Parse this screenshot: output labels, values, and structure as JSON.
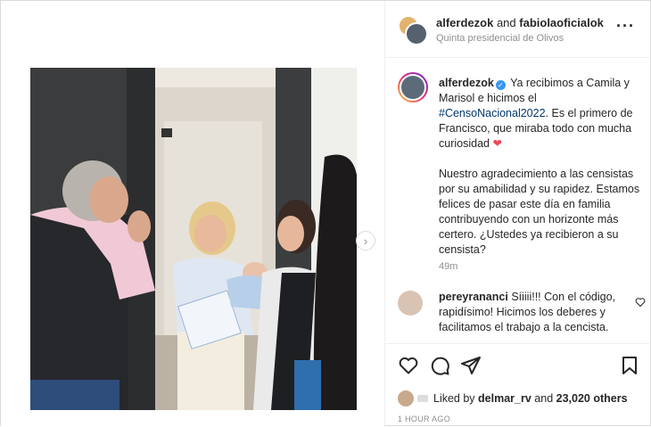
{
  "post": {
    "header": {
      "author": "alferdezok",
      "and": "and",
      "coauthor": "fabiolaoficialok",
      "location": "Quinta presidencial de Olivos",
      "more_icon": "more-horizontal-icon"
    },
    "caption": {
      "username": "alferdezok",
      "text_1": "Ya recibimos a Camila y Marisol e hicimos el",
      "hashtag": "#CensoNacional2022",
      "text_2": ". Es el primero de Francisco, que miraba todo con mucha curiosidad",
      "heart": "❤",
      "text_3": "Nuestro agradecimiento a las censistas por su amabilidad y su rapidez. Estamos felices de pasar este día en familia contribuyendo con un horizonte más certero. ¿Ustedes ya recibieron a su censista?",
      "time": "49m"
    },
    "comments": [
      {
        "username": "pereyrananci",
        "text": "Síiiii!!! Con el código, rapidísimo! Hicimos los deberes y facilitamos el trabajo a la cencista."
      }
    ],
    "likes": {
      "prefix": "Liked by",
      "user": "delmar_rv",
      "and": "and",
      "count": "23,020 others"
    },
    "timestamp": "1 HOUR AGO",
    "colors": {
      "accent_blue": "#3897f0",
      "heart_red": "#ed4956",
      "hashtag": "#00376b"
    }
  }
}
